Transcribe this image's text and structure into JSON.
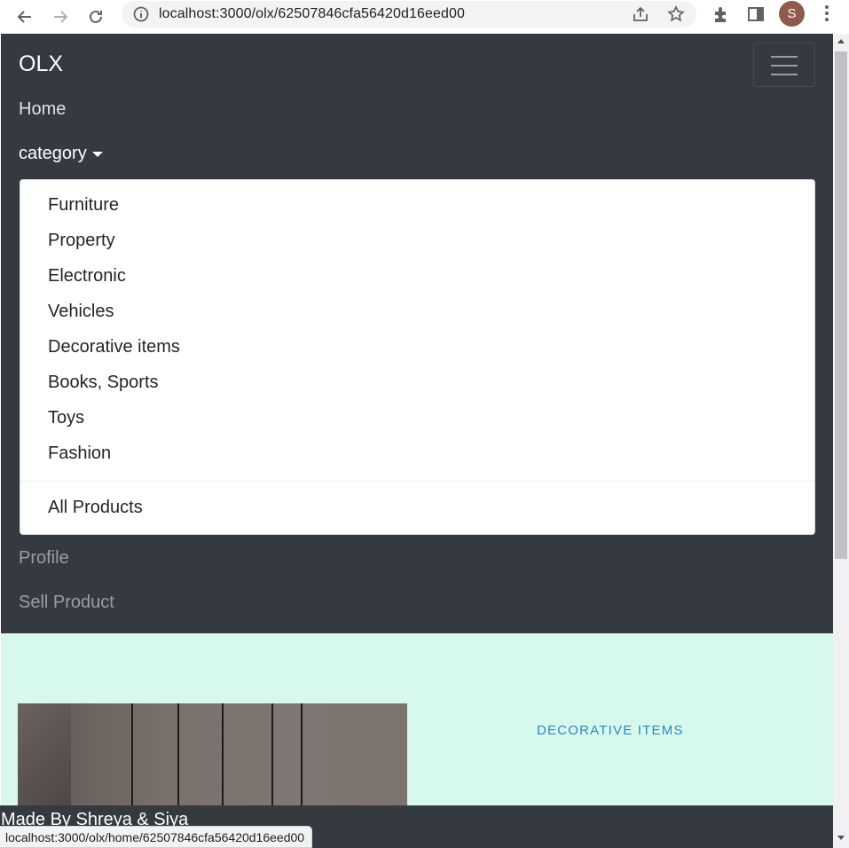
{
  "browser": {
    "url": "localhost:3000/olx/62507846cfa56420d16eed00",
    "profile_initial": "S",
    "status_url": "localhost:3000/olx/home/62507846cfa56420d16eed00"
  },
  "navbar": {
    "brand": "OLX",
    "home": "Home",
    "category": "category",
    "profile": "Profile",
    "sell": "Sell Product"
  },
  "dropdown": {
    "items": [
      "Furniture",
      "Property",
      "Electronic",
      "Vehicles",
      "Decorative items",
      "Books, Sports",
      "Toys",
      "Fashion"
    ],
    "all_products": "All Products"
  },
  "product": {
    "category_label": "DECORATIVE ITEMS"
  },
  "footer": {
    "text": "Made By Shreya & Siya"
  },
  "colors": {
    "navbar_bg": "#343a40",
    "content_bg": "#d7f8ec",
    "link_blue": "#2f87c4"
  }
}
